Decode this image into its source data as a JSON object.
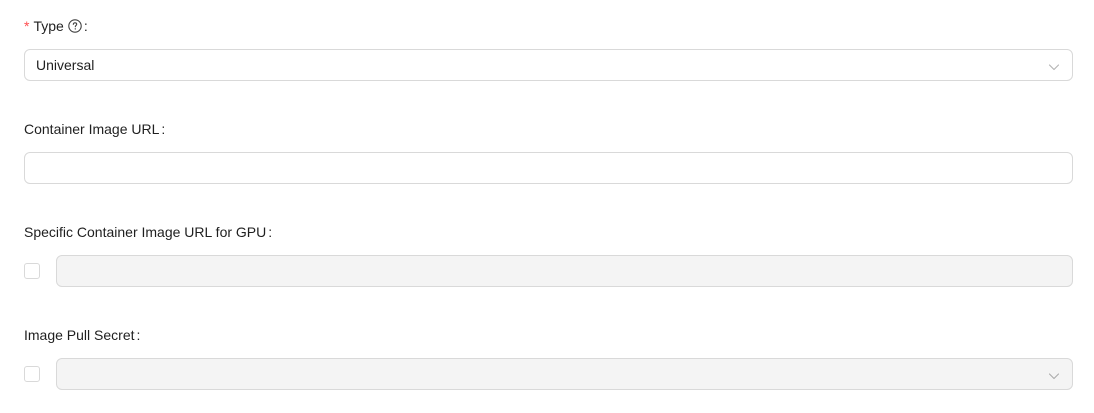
{
  "form": {
    "type": {
      "required_mark": "*",
      "label": "Type",
      "colon": ":",
      "value": "Universal"
    },
    "container_image_url": {
      "label": "Container Image URL",
      "colon": ":",
      "value": ""
    },
    "gpu_image_url": {
      "label": "Specific Container Image URL for GPU",
      "colon": ":",
      "checked": false,
      "value": ""
    },
    "image_pull_secret": {
      "label": "Image Pull Secret",
      "colon": ":",
      "checked": false,
      "value": ""
    }
  },
  "icons": {
    "help": "question-circle-icon",
    "select_arrow": "chevron-down-icon"
  },
  "colors": {
    "required": "#ff4d4f",
    "border": "#d9d9d9",
    "disabled_bg": "#f4f4f4"
  }
}
